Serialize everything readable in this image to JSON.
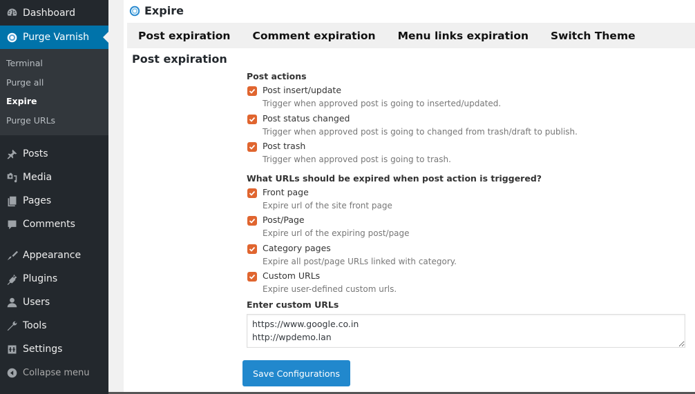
{
  "sidebar": {
    "top": [
      {
        "label": "Dashboard",
        "icon": "dashboard-icon"
      },
      {
        "label": "Purge Varnish",
        "icon": "purge-varnish-icon",
        "active": true
      }
    ],
    "submenu": [
      {
        "label": "Terminal"
      },
      {
        "label": "Purge all"
      },
      {
        "label": "Expire",
        "current": true
      },
      {
        "label": "Purge URLs"
      }
    ],
    "group1": [
      {
        "label": "Posts",
        "icon": "pin-icon"
      },
      {
        "label": "Media",
        "icon": "media-icon"
      },
      {
        "label": "Pages",
        "icon": "pages-icon"
      },
      {
        "label": "Comments",
        "icon": "comment-icon"
      }
    ],
    "group2": [
      {
        "label": "Appearance",
        "icon": "brush-icon"
      },
      {
        "label": "Plugins",
        "icon": "plug-icon"
      },
      {
        "label": "Users",
        "icon": "user-icon"
      },
      {
        "label": "Tools",
        "icon": "wrench-icon"
      },
      {
        "label": "Settings",
        "icon": "settings-icon"
      }
    ],
    "collapse": {
      "label": "Collapse menu",
      "icon": "collapse-arrow-icon"
    }
  },
  "page": {
    "title": "Expire",
    "tabs": [
      "Post expiration",
      "Comment expiration",
      "Menu links expiration",
      "Switch Theme"
    ],
    "section_title": "Post expiration"
  },
  "form": {
    "post_actions": {
      "label": "Post actions",
      "options": [
        {
          "label": "Post insert/update",
          "desc": "Trigger when approved post is going to inserted/updated.",
          "checked": true
        },
        {
          "label": "Post status changed",
          "desc": "Trigger when approved post is going to changed from trash/draft to publish.",
          "checked": true
        },
        {
          "label": "Post trash",
          "desc": "Trigger when approved post is going to trash.",
          "checked": true
        }
      ]
    },
    "urls": {
      "label": "What URLs should be expired when post action is triggered?",
      "options": [
        {
          "label": "Front page",
          "desc": "Expire url of the site front page",
          "checked": true
        },
        {
          "label": "Post/Page",
          "desc": "Expire url of the expiring post/page",
          "checked": true
        },
        {
          "label": "Category pages",
          "desc": "Expire all post/page URLs linked with category.",
          "checked": true
        },
        {
          "label": "Custom URLs",
          "desc": "Expire user-defined custom urls.",
          "checked": true
        }
      ]
    },
    "custom_urls": {
      "label": "Enter custom URLs",
      "value": "https://www.google.co.in\nhttp://wpdemo.lan"
    },
    "save_label": "Save Configurations"
  },
  "colors": {
    "sidebar_bg": "#23282d",
    "active_menu": "#0073aa",
    "checkbox": "#e0652f",
    "button": "#2188cd"
  }
}
